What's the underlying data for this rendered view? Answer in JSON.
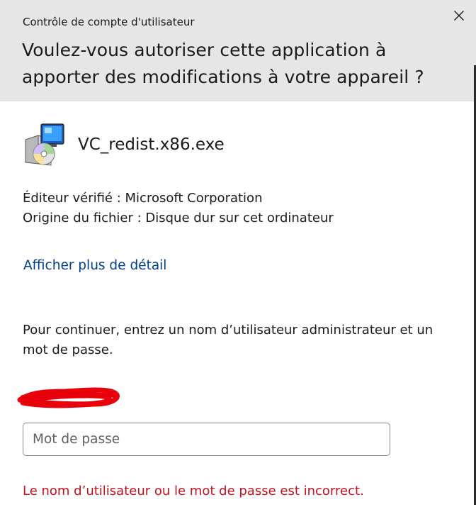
{
  "window": {
    "caption": "Contrôle de compte d'utilisateur",
    "close_icon": "close-icon"
  },
  "header": {
    "question": "Voulez-vous autoriser cette application à apporter des modifications à votre appareil ?"
  },
  "app": {
    "icon": "installer-package-icon",
    "name": "VC_redist.x86.exe"
  },
  "info": {
    "publisher": "Éditeur vérifié : Microsoft Corporation",
    "origin": "Origine du fichier : Disque dur sur cet ordinateur"
  },
  "details_link": "Afficher plus de détail",
  "prompt": "Pour continuer, entrez un nom d’utilisateur administrateur et un mot de passe.",
  "credentials": {
    "username_redacted": true,
    "password_placeholder": "Mot de passe",
    "password_value": ""
  },
  "error": "Le nom d’utilisateur ou le mot de passe est incorrect.",
  "colors": {
    "header_bg": "#e6e6e6",
    "link": "#003e92",
    "error": "#c50f1f",
    "redaction": "#e8000b"
  }
}
